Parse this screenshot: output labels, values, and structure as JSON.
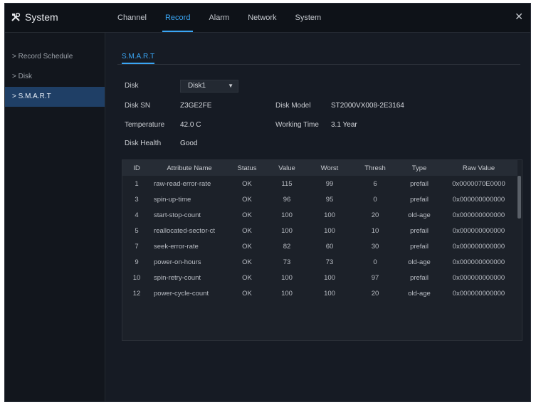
{
  "app": {
    "title": "System"
  },
  "tabs": [
    "Channel",
    "Record",
    "Alarm",
    "Network",
    "System"
  ],
  "active_tab": "Record",
  "sidebar": {
    "items": [
      "> Record Schedule",
      "> Disk",
      "> S.M.A.R.T"
    ],
    "active": "> S.M.A.R.T"
  },
  "subtab": "S.M.A.R.T",
  "disk": {
    "disk_label": "Disk",
    "disk_value": "Disk1",
    "disk_sn_label": "Disk SN",
    "disk_sn_value": "Z3GE2FE",
    "disk_model_label": "Disk Model",
    "disk_model_value": "ST2000VX008-2E3164",
    "temperature_label": "Temperature",
    "temperature_value": "42.0 C",
    "working_time_label": "Working Time",
    "working_time_value": "3.1 Year",
    "health_label": "Disk Health",
    "health_value": "Good"
  },
  "table": {
    "headers": [
      "ID",
      "Attribute Name",
      "Status",
      "Value",
      "Worst",
      "Thresh",
      "Type",
      "Raw Value"
    ],
    "rows": [
      [
        "1",
        "raw-read-error-rate",
        "OK",
        "115",
        "99",
        "6",
        "prefail",
        "0x0000070E0000"
      ],
      [
        "3",
        "spin-up-time",
        "OK",
        "96",
        "95",
        "0",
        "prefail",
        "0x000000000000"
      ],
      [
        "4",
        "start-stop-count",
        "OK",
        "100",
        "100",
        "20",
        "old-age",
        "0x000000000000"
      ],
      [
        "5",
        "reallocated-sector-ct",
        "OK",
        "100",
        "100",
        "10",
        "prefail",
        "0x000000000000"
      ],
      [
        "7",
        "seek-error-rate",
        "OK",
        "82",
        "60",
        "30",
        "prefail",
        "0x000000000000"
      ],
      [
        "9",
        "power-on-hours",
        "OK",
        "73",
        "73",
        "0",
        "old-age",
        "0x000000000000"
      ],
      [
        "10",
        "spin-retry-count",
        "OK",
        "100",
        "100",
        "97",
        "prefail",
        "0x000000000000"
      ],
      [
        "12",
        "power-cycle-count",
        "OK",
        "100",
        "100",
        "20",
        "old-age",
        "0x000000000000"
      ]
    ]
  },
  "colors": {
    "accent": "#3aa6f5",
    "background": "#161b24",
    "sidebar_active": "#1f3f66"
  },
  "icons": {
    "logo": "tools-icon",
    "close": "close-icon",
    "select": "chevron-down-icon"
  }
}
